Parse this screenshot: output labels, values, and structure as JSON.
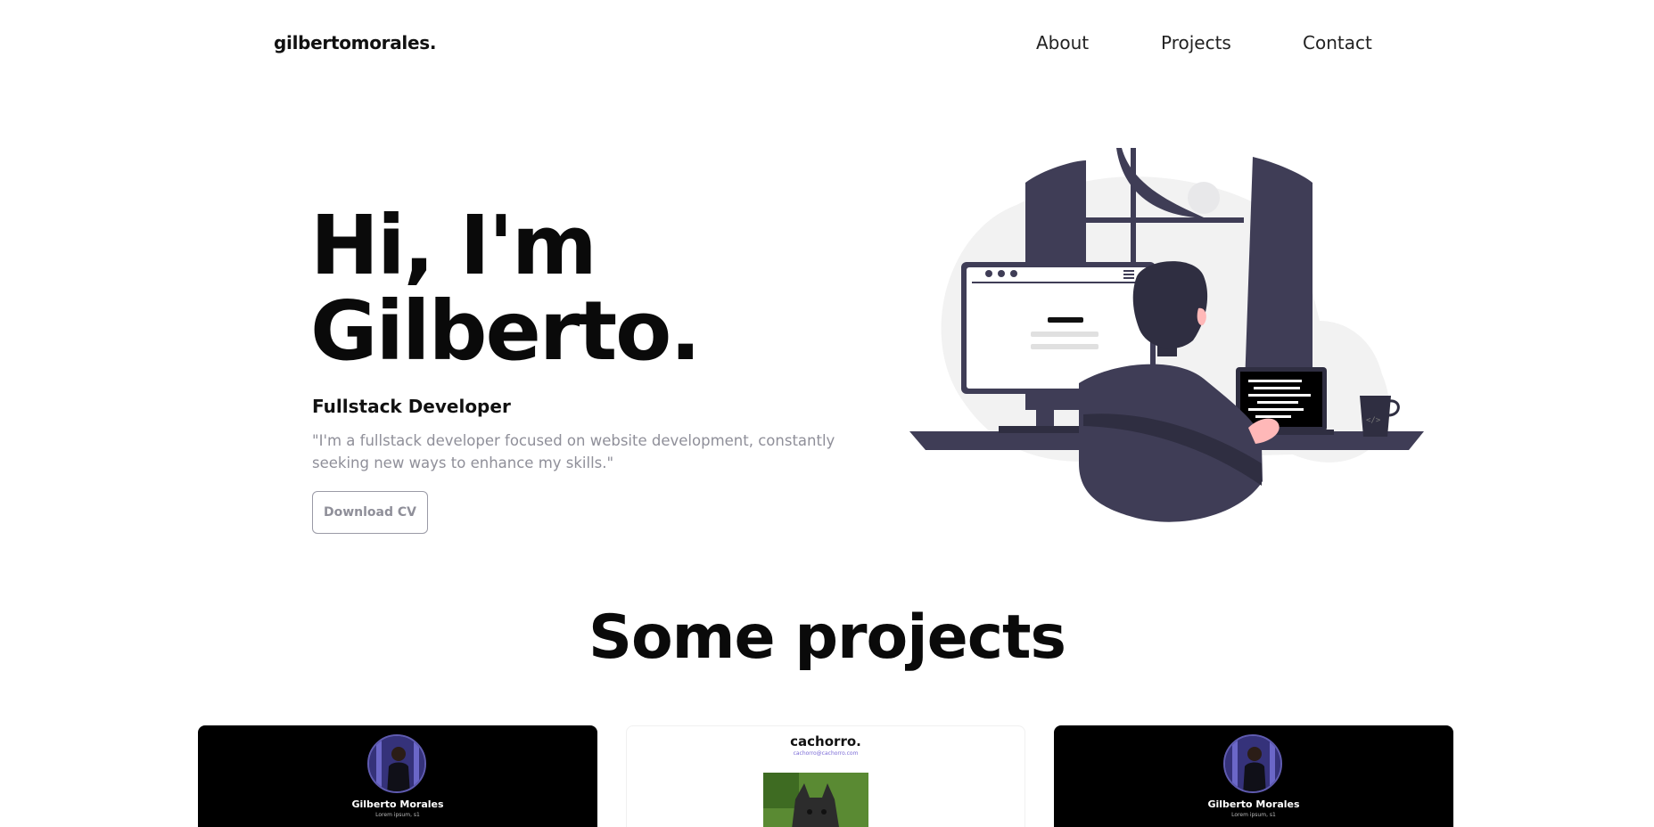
{
  "nav": {
    "logo": "gilbertomorales.",
    "links": [
      "About",
      "Projects",
      "Contact"
    ]
  },
  "hero": {
    "title_line1": "Hi, I'm",
    "title_line2": "Gilberto.",
    "role": "Fullstack Developer",
    "quote": "\"I'm a fullstack developer focused on website development, constantly seeking new ways to enhance my skills.\"",
    "cv_button": "Download CV"
  },
  "projects": {
    "title_light": "Some",
    "title_bold": "projects",
    "cards": [
      {
        "name": "Gilberto Morales",
        "subtitle": "Lorem ipsum, s1"
      },
      {
        "name": "cachorro.",
        "subtitle": "cachorro@cachorro.com"
      },
      {
        "name": "Gilberto Morales",
        "subtitle": "Lorem ipsum, s1"
      }
    ]
  },
  "colors": {
    "dark_figure": "#3f3d56",
    "blob": "#f2f2f2",
    "skin": "#ffb8b8",
    "hair": "#2f2e41"
  }
}
